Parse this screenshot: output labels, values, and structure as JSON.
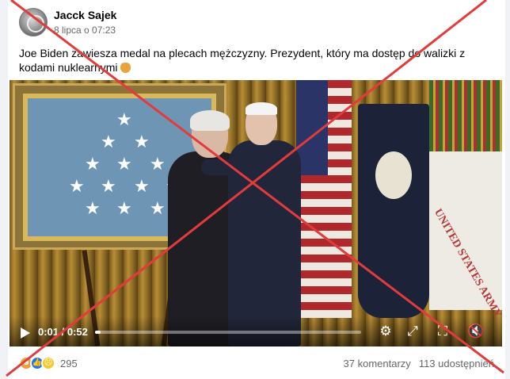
{
  "post": {
    "author": "Jacck Sajek",
    "timestamp": "8 lipca o 07:23",
    "text": "Joe Biden zawiesza medal na plecach mężczyzny. Prezydent, który ma dostęp do walizki z kodami nuklearnymi",
    "emoji": "facepalm-emoji"
  },
  "video": {
    "current_time": "0:01",
    "duration": "0:52",
    "progress_fraction": 0.02,
    "flag_text": "UNITED STATES ARMY",
    "icons": [
      "play-icon",
      "settings-icon",
      "expand-icon",
      "fullscreen-icon",
      "mute-icon"
    ]
  },
  "footer": {
    "reactions": [
      "like",
      "haha",
      "wow"
    ],
    "reaction_count": "295",
    "comments": "37 komentarzy",
    "shares": "113 udostępnień"
  },
  "overlay": {
    "cross_color": "#e23b3b"
  }
}
